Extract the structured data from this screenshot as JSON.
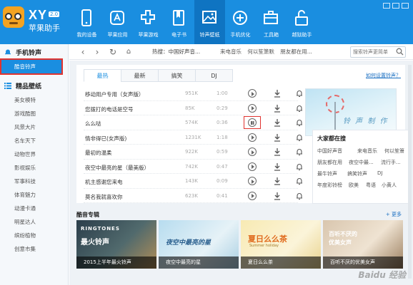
{
  "app": {
    "name": "XY",
    "version": "2.0",
    "subtitle": "苹果助手"
  },
  "nav": [
    {
      "label": "我的设备",
      "icon": "phone-icon"
    },
    {
      "label": "苹果应用",
      "icon": "apps-icon"
    },
    {
      "label": "苹果游戏",
      "icon": "game-icon"
    },
    {
      "label": "电子书",
      "icon": "book-icon"
    },
    {
      "label": "铃声壁纸",
      "icon": "picture-icon",
      "active": true
    },
    {
      "label": "手机优化",
      "icon": "plus-circle-icon"
    },
    {
      "label": "工具箱",
      "icon": "toolbox-icon"
    },
    {
      "label": "越狱助手",
      "icon": "unlock-icon"
    }
  ],
  "sidebar": {
    "group1": "手机铃声",
    "group1_items": [
      "酷音铃声"
    ],
    "group2": "精品壁纸",
    "group2_items": [
      "美女模特",
      "游戏酷图",
      "风景大片",
      "名车天下",
      "动物世界",
      "影视娱乐",
      "军事科技",
      "体育魅力",
      "动漫卡通",
      "明星达人",
      "缤纷植物",
      "创意市集"
    ]
  },
  "toolbar": {
    "hot_label": "热搜：中国好声音...",
    "hot_links": [
      "来电音乐",
      "何以笙箫默",
      "朋友都在用..."
    ],
    "search_placeholder": "搜索铃声更简单"
  },
  "tabs": [
    "最热",
    "最新",
    "搞笑",
    "DJ"
  ],
  "howto": "如何设置铃声？",
  "songs": [
    {
      "name": "移动用户专用（女声版）",
      "size": "951K",
      "duration": "1:00"
    },
    {
      "name": "您拨打的电话是空号",
      "size": "85K",
      "duration": "0:29"
    },
    {
      "name": "么么哒",
      "size": "574K",
      "duration": "0:36",
      "playing": true
    },
    {
      "name": "情非得已(女声版)",
      "size": "1231K",
      "duration": "1:18"
    },
    {
      "name": "最初的温柔",
      "size": "922K",
      "duration": "0:59"
    },
    {
      "name": "夜空中最亮的星（最美版）",
      "size": "742K",
      "duration": "0:47"
    },
    {
      "name": "机主感谢您来电",
      "size": "143K",
      "duration": "0:09"
    },
    {
      "name": "莫名我就喜欢你",
      "size": "623K",
      "duration": "0:41"
    }
  ],
  "banner_text": "铃 声 制 作",
  "hot_search": {
    "title": "大家都在搜",
    "keywords": [
      "中国好声音",
      "来电音乐",
      "何以笙箫",
      "朋友都在用",
      "夜空中最...",
      "流行手...",
      "最牛铃声",
      "搞笑铃声",
      "DJ",
      "年度彩铃榜",
      "欧美",
      "粤语",
      "小黄人"
    ]
  },
  "albums": {
    "title": "酷音专辑",
    "more": "+ 更多",
    "items": [
      {
        "caption": "2015上半年最火铃声",
        "art": "RINGTONES",
        "art2": "最火铃声"
      },
      {
        "caption": "夜空中最亮的星",
        "art": "夜空中最亮的星",
        "art2": ""
      },
      {
        "caption": "夏日么么茶",
        "art": "夏日么么茶",
        "art2": "Summer holiday"
      },
      {
        "caption": "百听不厌的优美女声",
        "art": "百听不厌的",
        "art2": "优美女声"
      }
    ]
  },
  "watermark": "Baidu 经验"
}
